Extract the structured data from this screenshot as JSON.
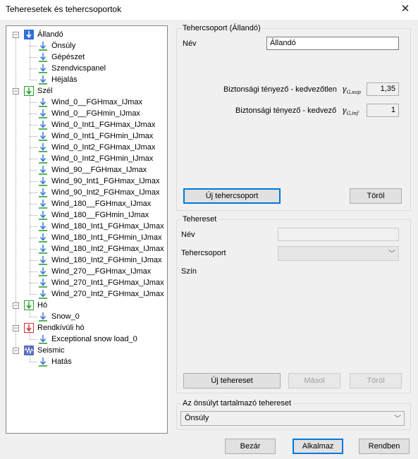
{
  "window": {
    "title": "Teheresetek és tehercsoportok",
    "close_glyph": "✕"
  },
  "tree": [
    {
      "label": "Állandó",
      "level": 0,
      "expanded": true,
      "icon": "permanent-load-icon",
      "color": "#2f6fd8"
    },
    {
      "label": "Önsúly",
      "level": 1,
      "icon": "load-case-icon"
    },
    {
      "label": "Gépészet",
      "level": 1,
      "icon": "load-case-icon"
    },
    {
      "label": "Szendvicspanel",
      "level": 1,
      "icon": "load-case-icon"
    },
    {
      "label": "Héjalás",
      "level": 1,
      "icon": "load-case-icon"
    },
    {
      "label": "Szél",
      "level": 0,
      "expanded": true,
      "icon": "variable-load-icon",
      "color": "#2aa02a"
    },
    {
      "label": "Wind_0__FGHmax_IJmax",
      "level": 1,
      "icon": "load-case-icon"
    },
    {
      "label": "Wind_0__FGHmin_IJmax",
      "level": 1,
      "icon": "load-case-icon"
    },
    {
      "label": "Wind_0_Int1_FGHmax_IJmax",
      "level": 1,
      "icon": "load-case-icon"
    },
    {
      "label": "Wind_0_Int1_FGHmin_IJmax",
      "level": 1,
      "icon": "load-case-icon"
    },
    {
      "label": "Wind_0_Int2_FGHmax_IJmax",
      "level": 1,
      "icon": "load-case-icon"
    },
    {
      "label": "Wind_0_Int2_FGHmin_IJmax",
      "level": 1,
      "icon": "load-case-icon"
    },
    {
      "label": "Wind_90__FGHmax_IJmax",
      "level": 1,
      "icon": "load-case-icon"
    },
    {
      "label": "Wind_90_Int1_FGHmax_IJmax",
      "level": 1,
      "icon": "load-case-icon"
    },
    {
      "label": "Wind_90_Int2_FGHmax_IJmax",
      "level": 1,
      "icon": "load-case-icon"
    },
    {
      "label": "Wind_180__FGHmax_IJmax",
      "level": 1,
      "icon": "load-case-icon"
    },
    {
      "label": "Wind_180__FGHmin_IJmax",
      "level": 1,
      "icon": "load-case-icon"
    },
    {
      "label": "Wind_180_Int1_FGHmax_IJmax",
      "level": 1,
      "icon": "load-case-icon"
    },
    {
      "label": "Wind_180_Int1_FGHmin_IJmax",
      "level": 1,
      "icon": "load-case-icon"
    },
    {
      "label": "Wind_180_Int2_FGHmax_IJmax",
      "level": 1,
      "icon": "load-case-icon"
    },
    {
      "label": "Wind_180_Int2_FGHmin_IJmax",
      "level": 1,
      "icon": "load-case-icon"
    },
    {
      "label": "Wind_270__FGHmax_IJmax",
      "level": 1,
      "icon": "load-case-icon"
    },
    {
      "label": "Wind_270_Int1_FGHmax_IJmax",
      "level": 1,
      "icon": "load-case-icon"
    },
    {
      "label": "Wind_270_Int2_FGHmax_IJmax",
      "level": 1,
      "icon": "load-case-icon"
    },
    {
      "label": "Hó",
      "level": 0,
      "expanded": true,
      "icon": "variable-load-icon",
      "color": "#2aa02a"
    },
    {
      "label": "Snow_0",
      "level": 1,
      "icon": "load-case-icon"
    },
    {
      "label": "Rendkívüli hó",
      "level": 0,
      "expanded": true,
      "icon": "accidental-load-icon",
      "color": "#d03030"
    },
    {
      "label": "Exceptional snow load_0",
      "level": 1,
      "icon": "load-case-icon"
    },
    {
      "label": "Seismic",
      "level": 0,
      "expanded": true,
      "icon": "seismic-load-icon",
      "color": "#5b6fbf"
    },
    {
      "label": "Hatás",
      "level": 1,
      "icon": "load-case-icon"
    }
  ],
  "load_group": {
    "legend": "Tehercsoport (Állandó)",
    "name_label": "Név",
    "name_value": "Állandó",
    "unfav_label": "Biztonsági tényező - kedvezőtlen",
    "unfav_symbol": "γ",
    "unfav_sub": "G,sup",
    "unfav_value": "1,35",
    "fav_label": "Biztonsági tényező - kedvező",
    "fav_symbol": "γ",
    "fav_sub": "G,inf",
    "fav_value": "1",
    "new_button": "Új tehercsoport",
    "delete_button": "Töröl"
  },
  "load_case": {
    "legend": "Tehereset",
    "name_label": "Név",
    "name_value": "",
    "group_label": "Tehercsoport",
    "group_value": "",
    "color_label": "Szín",
    "new_button": "Új tehereset",
    "copy_button": "Másol",
    "delete_button": "Töröl"
  },
  "self_weight": {
    "legend": "Az önsúlyt tartalmazó tehereset",
    "value": "Önsúly"
  },
  "footer": {
    "close": "Bezár",
    "apply": "Alkalmaz",
    "ok": "Rendben"
  },
  "colors": {
    "accent": "#0078d7",
    "arrow_blue": "#2f6fd8",
    "line_green": "#2aa02a"
  }
}
